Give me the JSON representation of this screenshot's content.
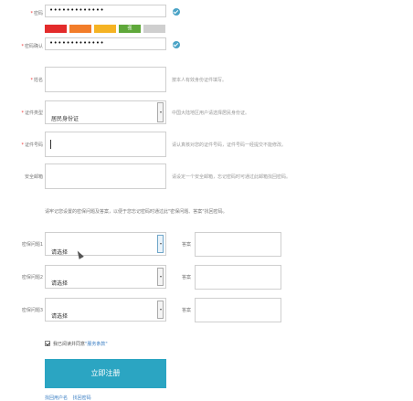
{
  "form": {
    "password": {
      "label": "密码",
      "value": "•••••••••••••"
    },
    "strength": {
      "label_active": "强",
      "segments": [
        {
          "color": "#e32b2b"
        },
        {
          "color": "#f27d2a"
        },
        {
          "color": "#f5b324"
        },
        {
          "color": "#5fa83a"
        },
        {
          "color": "#cfcfcf"
        }
      ]
    },
    "confirm_password": {
      "label": "密码确认",
      "value": "•••••••••••••"
    },
    "name": {
      "label": "姓名",
      "hint": "按本人有效身份证件填写。"
    },
    "id_type": {
      "label": "证件类型",
      "value": "居民身份证",
      "hint": "中国大陆地区用户请选择居民身份证。"
    },
    "id_number": {
      "label": "证件号码",
      "hint": "请认真核对您的证件号码，证件号码一经提交不能修改。"
    },
    "security_email": {
      "label": "安全邮箱",
      "hint": "请设定一个安全邮箱，忘记密码时可通过此邮箱找回密码。"
    },
    "security_notice": "请牢记您设置的密保问题及答案，以便于您忘记密码时通过此\"密保问题、答案\"找回密码。",
    "questions": [
      {
        "label": "密保问题1",
        "placeholder": "请选择",
        "answer_label": "答案"
      },
      {
        "label": "密保问题2",
        "placeholder": "请选择",
        "answer_label": "答案"
      },
      {
        "label": "密保问题3",
        "placeholder": "请选择",
        "answer_label": "答案"
      }
    ],
    "agreement": {
      "prefix": "我已阅读并同意",
      "link": "\"服务条款\""
    },
    "submit_label": "立即注册",
    "footer_links": [
      "找回用户名",
      "找回密码"
    ]
  },
  "colors": {
    "accent": "#2ba5c2",
    "required": "#e33333",
    "link": "#3b7fc4"
  }
}
